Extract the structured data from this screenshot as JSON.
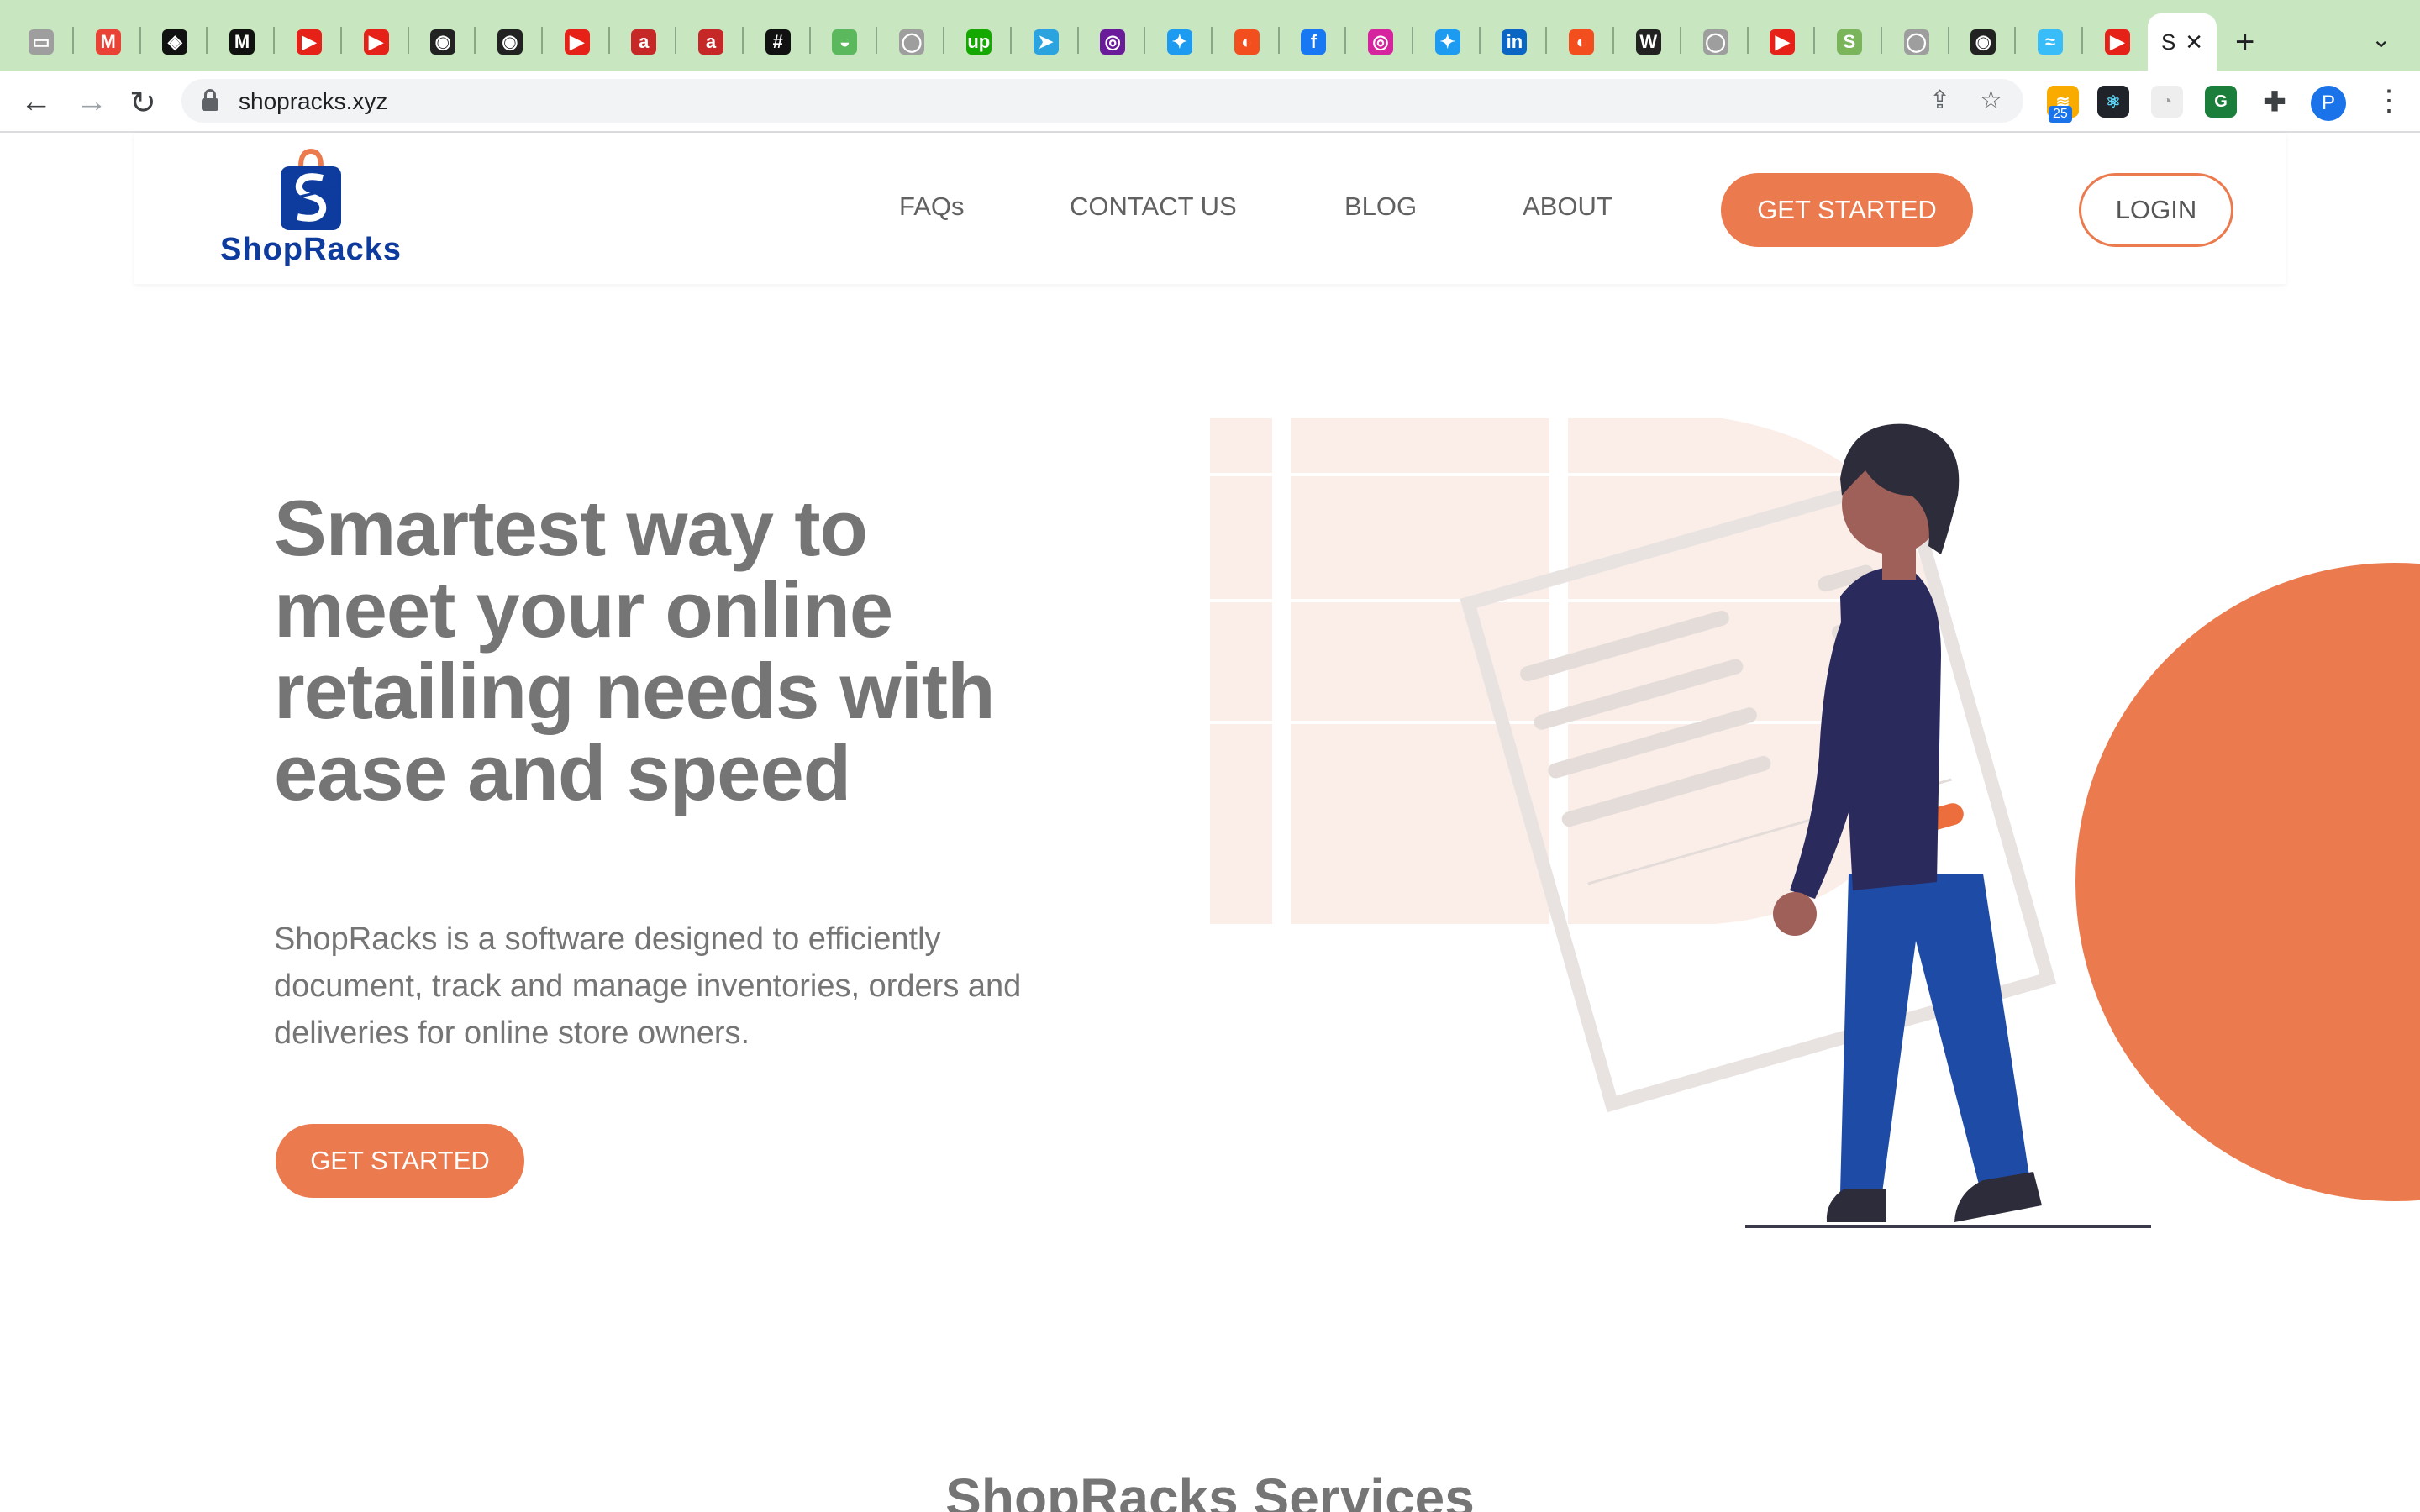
{
  "browser": {
    "tabs": [
      {
        "icon": "terminal-icon",
        "glyph": "▭",
        "color": "#9e9e9e"
      },
      {
        "icon": "gmail-icon",
        "glyph": "M",
        "color": "#ea4335"
      },
      {
        "icon": "codepen-icon",
        "glyph": "◈",
        "color": "#111111"
      },
      {
        "icon": "medium-icon",
        "glyph": "M",
        "color": "#111111"
      },
      {
        "icon": "youtube-icon",
        "glyph": "▶",
        "color": "#e62117"
      },
      {
        "icon": "youtube-icon",
        "glyph": "▶",
        "color": "#e62117"
      },
      {
        "icon": "globe-icon",
        "glyph": "◉",
        "color": "#222222"
      },
      {
        "icon": "globe-icon",
        "glyph": "◉",
        "color": "#222222"
      },
      {
        "icon": "youtube-icon",
        "glyph": "▶",
        "color": "#e62117"
      },
      {
        "icon": "app-icon",
        "glyph": "a",
        "color": "#c62828"
      },
      {
        "icon": "app-icon",
        "glyph": "a",
        "color": "#c62828"
      },
      {
        "icon": "hashnode-icon",
        "glyph": "#",
        "color": "#111111"
      },
      {
        "icon": "android-icon",
        "glyph": "◒",
        "color": "#5cb85c"
      },
      {
        "icon": "github-icon",
        "glyph": "◯",
        "color": "#9e9e9e"
      },
      {
        "icon": "upwork-icon",
        "glyph": "up",
        "color": "#14a800"
      },
      {
        "icon": "telegram-icon",
        "glyph": "➤",
        "color": "#2aa3df"
      },
      {
        "icon": "chrome-icon",
        "glyph": "◎",
        "color": "#6a1b9a"
      },
      {
        "icon": "twitter-icon",
        "glyph": "✦",
        "color": "#1d9bf0"
      },
      {
        "icon": "figma-icon",
        "glyph": "◐",
        "color": "#f24e1e"
      },
      {
        "icon": "facebook-icon",
        "glyph": "f",
        "color": "#1877f2"
      },
      {
        "icon": "instagram-icon",
        "glyph": "◎",
        "color": "#d6249f"
      },
      {
        "icon": "twitter-icon",
        "glyph": "✦",
        "color": "#1d9bf0"
      },
      {
        "icon": "linkedin-icon",
        "glyph": "in",
        "color": "#0a66c2"
      },
      {
        "icon": "figma-icon",
        "glyph": "◐",
        "color": "#f24e1e"
      },
      {
        "icon": "wikipedia-icon",
        "glyph": "W",
        "color": "#222222"
      },
      {
        "icon": "github-icon",
        "glyph": "◯",
        "color": "#9e9e9e"
      },
      {
        "icon": "youtube-icon",
        "glyph": "▶",
        "color": "#e62117"
      },
      {
        "icon": "shopify-icon",
        "glyph": "S",
        "color": "#7ab55c"
      },
      {
        "icon": "github-icon",
        "glyph": "◯",
        "color": "#9e9e9e"
      },
      {
        "icon": "globe-icon",
        "glyph": "◉",
        "color": "#222222"
      },
      {
        "icon": "tailwind-icon",
        "glyph": "≈",
        "color": "#38bdf8"
      },
      {
        "icon": "youtube-icon",
        "glyph": "▶",
        "color": "#e62117"
      }
    ],
    "active_tab_title": "S",
    "url": "shopracks.xyz",
    "extension_badge": "25",
    "profile_initial": "P"
  },
  "site": {
    "brand": "ShopRacks",
    "nav": {
      "faqs": "FAQs",
      "contact": "CONTACT US",
      "blog": "BLOG",
      "about": "ABOUT",
      "get_started": "GET STARTED",
      "login": "LOGIN"
    },
    "hero": {
      "title": "Smartest way to meet your online retailing needs with ease and speed",
      "description": "ShopRacks is a software designed to efficiently document, track and manage inventories, orders and deliveries for online store owners.",
      "cta": "GET STARTED"
    },
    "services_title": "ShopRacks Services"
  },
  "colors": {
    "accent": "#eb7a4e",
    "brand_blue": "#0d3b9e",
    "text_gray": "#757575",
    "tabstrip": "#c8e6c0"
  }
}
